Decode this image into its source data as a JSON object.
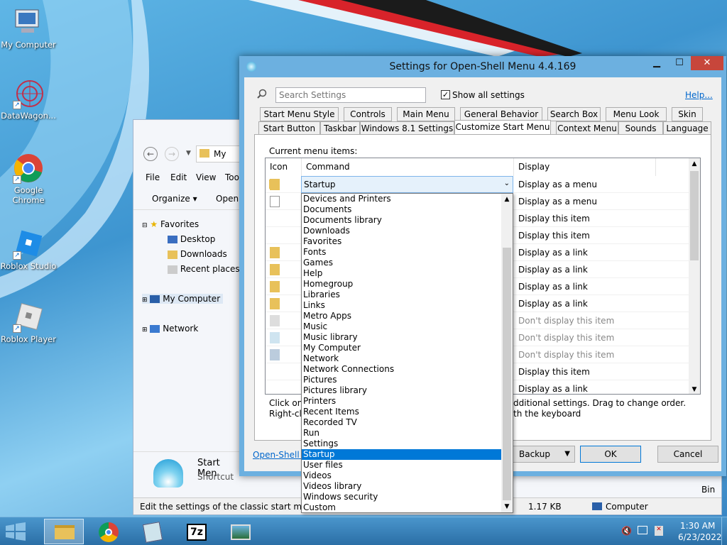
{
  "desktop": {
    "icons": [
      {
        "label": "My Computer",
        "icon": "computer-icon"
      },
      {
        "label": "DataWagon...",
        "icon": "datawagon-icon"
      },
      {
        "label": "Google Chrome",
        "icon": "chrome-icon"
      },
      {
        "label": "Roblox Studio",
        "icon": "roblox-studio-icon"
      },
      {
        "label": "Roblox Player",
        "icon": "roblox-player-icon"
      }
    ]
  },
  "explorer": {
    "address_partial": "My",
    "menu": [
      "File",
      "Edit",
      "View",
      "Too"
    ],
    "toolbar": {
      "organize": "Organize ▾",
      "open": "Open"
    },
    "nav": {
      "favorites": "Favorites",
      "desktop": "Desktop",
      "downloads": "Downloads",
      "recent": "Recent places",
      "my_computer": "My Computer",
      "network": "Network"
    },
    "preview": {
      "name": "Start Men",
      "type": "Shortcut"
    },
    "status": {
      "text": "Edit the settings of the classic start menu",
      "size": "1.17 KB",
      "location": "Computer"
    },
    "right_edge": "Bin"
  },
  "dialog": {
    "title": "Settings for Open-Shell Menu 4.4.169",
    "search_placeholder": "Search Settings",
    "show_all_label": "Show all settings",
    "help_link": "Help...",
    "tabs_row1": [
      "Start Menu Style",
      "Controls",
      "Main Menu",
      "General Behavior",
      "Search Box",
      "Menu Look",
      "Skin"
    ],
    "tabs_row2": [
      "Start Button",
      "Taskbar",
      "Windows 8.1 Settings",
      "Customize Start Menu",
      "Context Menu",
      "Sounds",
      "Language"
    ],
    "selected_tab": "Customize Start Menu",
    "current_items_label": "Current menu items:",
    "columns": [
      "Icon",
      "Command",
      "Display"
    ],
    "rows": [
      {
        "command": "Startup",
        "display": "Display as a menu",
        "dim": false
      },
      {
        "command": "",
        "display": "Display as a menu",
        "dim": false
      },
      {
        "command": "",
        "display": "Display this item",
        "dim": false
      },
      {
        "command": "",
        "display": "Display this item",
        "dim": false
      },
      {
        "command": "",
        "display": "Display as a link",
        "dim": false
      },
      {
        "command": "",
        "display": "Display as a link",
        "dim": false
      },
      {
        "command": "",
        "display": "Display as a link",
        "dim": false
      },
      {
        "command": "",
        "display": "Display as a link",
        "dim": false
      },
      {
        "command": "",
        "display": "Don't display this item",
        "dim": true
      },
      {
        "command": "",
        "display": "Don't display this item",
        "dim": true
      },
      {
        "command": "",
        "display": "Don't display this item",
        "dim": true
      },
      {
        "command": "",
        "display": "Display this item",
        "dim": false
      },
      {
        "command": "",
        "display": "Display as a link",
        "dim": false
      }
    ],
    "hint1_left": "Click on e",
    "hint1_right": "dditional settings. Drag to change order.",
    "hint2_left": "Right-clic",
    "hint2_right": "th the keyboard",
    "link_partial": "Open-Shell H",
    "backup_label": "Backup",
    "ok_label": "OK",
    "cancel_label": "Cancel",
    "dropdown_items": [
      "Devices and Printers",
      "Documents",
      "Documents library",
      "Downloads",
      "Favorites",
      "Fonts",
      "Games",
      "Help",
      "Homegroup",
      "Libraries",
      "Links",
      "Metro Apps",
      "Music",
      "Music library",
      "My Computer",
      "Network",
      "Network Connections",
      "Pictures",
      "Pictures library",
      "Printers",
      "Recent Items",
      "Recorded TV",
      "Run",
      "Settings",
      "Startup",
      "User files",
      "Videos",
      "Videos library",
      "Windows security",
      "Custom"
    ],
    "dropdown_selected": "Startup"
  },
  "taskbar": {
    "time": "1:30 AM",
    "date": "6/23/2022"
  }
}
